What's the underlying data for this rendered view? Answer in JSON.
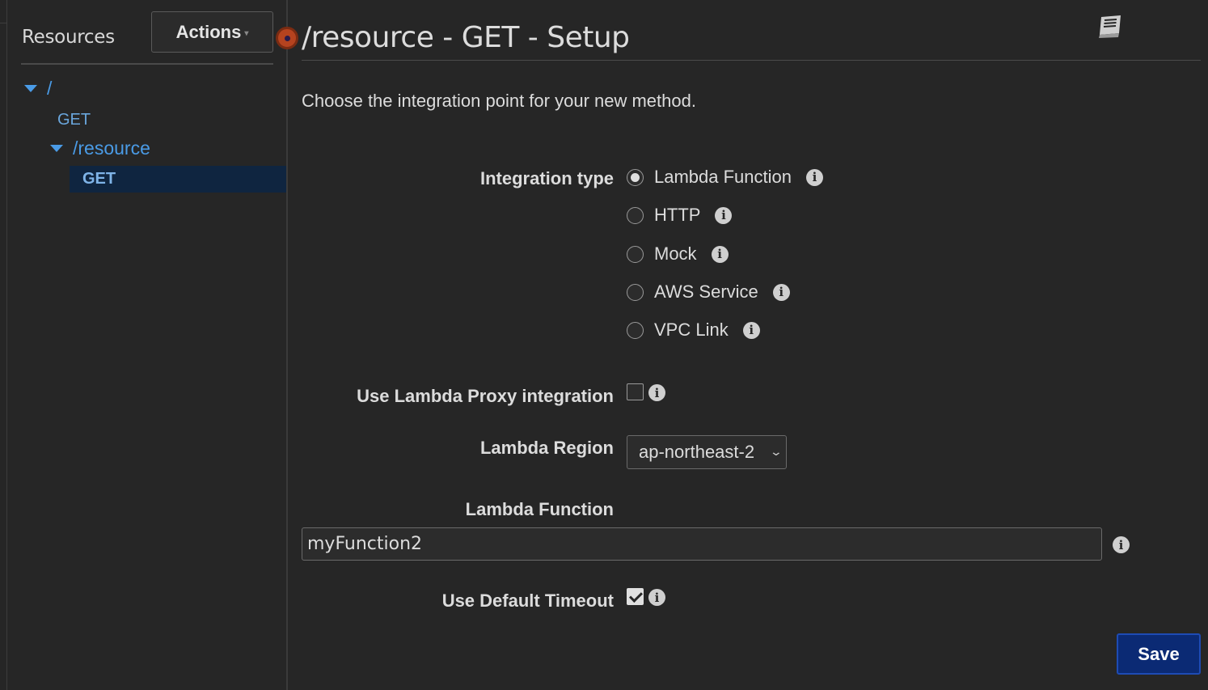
{
  "sidebar": {
    "title": "Resources",
    "actions_label": "Actions",
    "tree": {
      "root": "/",
      "root_method": "GET",
      "child": "/resource",
      "child_method": "GET"
    }
  },
  "main": {
    "title": "/resource - GET - Setup",
    "intro": "Choose the integration point for your new method.",
    "integration_type_label": "Integration type",
    "integration_options": [
      {
        "label": "Lambda Function",
        "selected": true
      },
      {
        "label": "HTTP",
        "selected": false
      },
      {
        "label": "Mock",
        "selected": false
      },
      {
        "label": "AWS Service",
        "selected": false
      },
      {
        "label": "VPC Link",
        "selected": false
      }
    ],
    "proxy_label": "Use Lambda Proxy integration",
    "proxy_checked": false,
    "region_label": "Lambda Region",
    "region_value": "ap-northeast-2",
    "function_label": "Lambda Function",
    "function_value": "myFunction2",
    "timeout_label": "Use Default Timeout",
    "timeout_checked": true,
    "save_label": "Save"
  },
  "icons": {
    "info": "i",
    "caret": "▾",
    "chevron": "⌄"
  }
}
